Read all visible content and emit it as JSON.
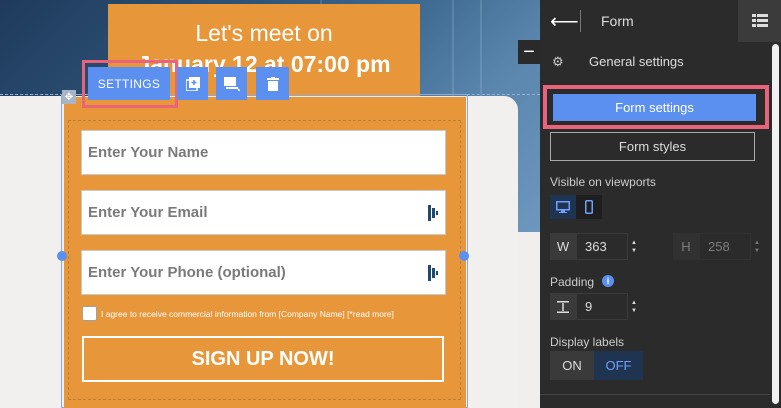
{
  "event": {
    "line1": "Let's meet on",
    "line2": "January 12 at 07:00 pm"
  },
  "form": {
    "fields": [
      {
        "placeholder": "Enter Your Name"
      },
      {
        "placeholder": "Enter Your Email"
      },
      {
        "placeholder": "Enter Your Phone (optional)"
      }
    ],
    "consent_text": "I agree to receive commercial information from [Company Name] [*read more]",
    "submit_label": "SIGN UP NOW!"
  },
  "toolbar": {
    "settings_label": "SETTINGS",
    "icons": [
      "duplicate-icon",
      "save-block-icon",
      "trash-icon"
    ]
  },
  "panel": {
    "title": "Form",
    "general_settings": "General settings",
    "form_settings": "Form settings",
    "form_styles": "Form styles",
    "visible_label": "Visible on viewports",
    "viewports": [
      "desktop-icon",
      "mobile-icon"
    ],
    "width_letter": "W",
    "width_value": "363",
    "height_letter": "H",
    "height_value": "258",
    "padding_label": "Padding",
    "padding_value": "9",
    "display_labels": "Display labels",
    "on_label": "ON",
    "off_label": "OFF"
  },
  "colors": {
    "accent": "#5b8ff0",
    "form_bg": "#e8963a",
    "highlight": "#e9647b",
    "panel_bg": "#2b2b2b"
  }
}
